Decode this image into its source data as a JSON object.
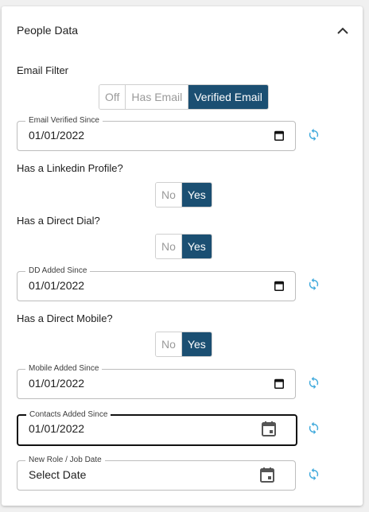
{
  "panel": {
    "title": "People Data"
  },
  "email_filter": {
    "label": "Email Filter",
    "options": [
      "Off",
      "Has Email",
      "Verified Email"
    ],
    "selected": "Verified Email"
  },
  "email_verified_since": {
    "label": "Email Verified Since",
    "value": "01/01/2022"
  },
  "linkedin": {
    "label": "Has a Linkedin Profile?",
    "options": [
      "No",
      "Yes"
    ],
    "selected": "Yes"
  },
  "direct_dial": {
    "label": "Has a Direct Dial?",
    "options": [
      "No",
      "Yes"
    ],
    "selected": "Yes"
  },
  "dd_added_since": {
    "label": "DD Added Since",
    "value": "01/01/2022"
  },
  "direct_mobile": {
    "label": "Has a Direct Mobile?",
    "options": [
      "No",
      "Yes"
    ],
    "selected": "Yes"
  },
  "mobile_added_since": {
    "label": "Mobile Added Since",
    "value": "01/01/2022"
  },
  "contacts_added_since": {
    "label": "Contacts Added Since",
    "value": "01/01/2022"
  },
  "new_role_date": {
    "label": "New Role / Job Date",
    "value": "Select Date"
  },
  "colors": {
    "accent": "#1b4f72",
    "refresh": "#3fa9dc"
  },
  "icons": {
    "collapse": "chevron-up-icon",
    "refresh": "refresh-icon",
    "calendar": "calendar-icon"
  }
}
